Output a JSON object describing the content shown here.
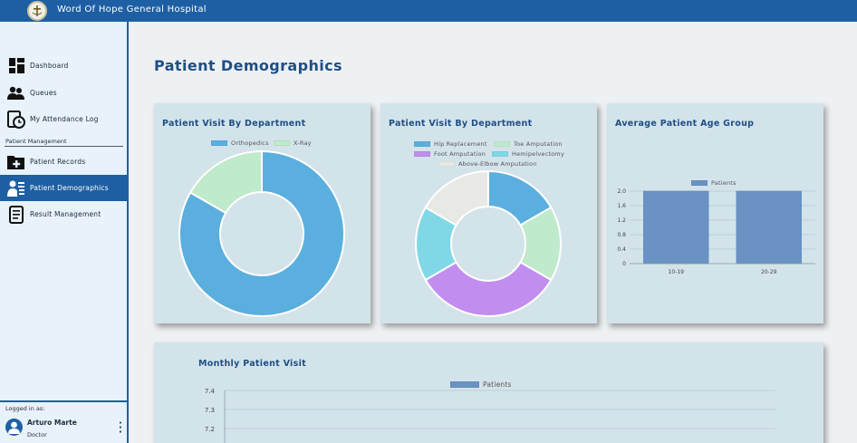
{
  "header": {
    "title": "Word Of Hope General Hospital"
  },
  "sidebar": {
    "items": [
      {
        "label": "Dashboard",
        "icon": "dashboard-icon"
      },
      {
        "label": "Queues",
        "icon": "people-icon"
      },
      {
        "label": "My Attendance Log",
        "icon": "clock-document-icon"
      },
      {
        "label": "Patient Records",
        "icon": "folder-plus-icon"
      },
      {
        "label": "Patient Demographics",
        "icon": "demographics-icon",
        "active": true
      },
      {
        "label": "Result Management",
        "icon": "scroll-icon"
      }
    ],
    "section_label": "Patient Management"
  },
  "footer": {
    "logged_label": "Logged in as:",
    "user_name": "Arturo Marte",
    "user_role": "Doctor"
  },
  "main": {
    "page_title": "Patient Demographics"
  },
  "colors": {
    "brand": "#1e5fa3",
    "title": "#1e4f85",
    "card": "#d3e3ea"
  },
  "chart_data": [
    {
      "type": "pie",
      "title": "Patient Visit By Department",
      "categories": [
        "Orthopedics",
        "X-Ray"
      ],
      "values": [
        5,
        1
      ],
      "colors": [
        "#5aafde",
        "#bfeacb"
      ]
    },
    {
      "type": "pie",
      "title": "Patient Visit By Department",
      "categories": [
        "Hip Replacement",
        "Toe Amputation",
        "Foot Amputation",
        "Hemipelvectomy",
        "Above-Elbow Amputation"
      ],
      "values": [
        1,
        1,
        2,
        1,
        1
      ],
      "colors": [
        "#5aafde",
        "#bfeacb",
        "#c18ef0",
        "#80d8e6",
        "#e8e8e4"
      ]
    },
    {
      "type": "bar",
      "title": "Average Patient Age Group",
      "categories": [
        "10-19",
        "20-29"
      ],
      "series": [
        {
          "name": "Patients",
          "values": [
            2,
            2
          ]
        }
      ],
      "ylim": [
        0,
        2
      ],
      "yticks": [
        "2.0",
        "1.6",
        "1.2",
        "0.8",
        "0.4",
        "0"
      ],
      "color": "#6a93c4"
    },
    {
      "type": "line",
      "title": "Monthly Patient Visit",
      "series": [
        {
          "name": "Patients"
        }
      ],
      "yticks": [
        "7.4",
        "7.3",
        "7.2"
      ],
      "color": "#6a93c4"
    }
  ]
}
